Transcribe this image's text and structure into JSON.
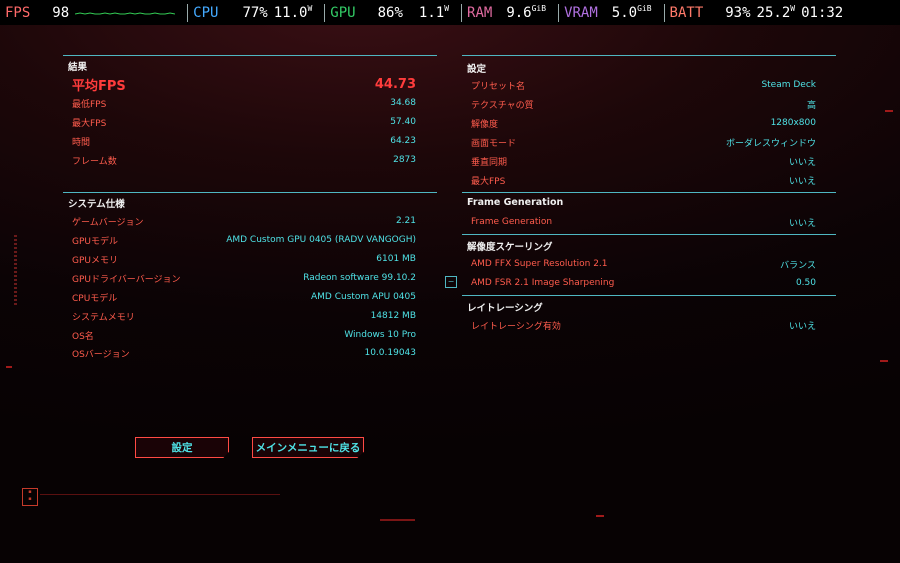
{
  "overlay": {
    "fps_label": "FPS",
    "fps_value": "98",
    "cpu_label": "CPU",
    "cpu_pct": "77%",
    "cpu_power": "11.0",
    "cpu_power_unit": "W",
    "gpu_label": "GPU",
    "gpu_pct": "86%",
    "gpu_power": "1.1",
    "gpu_power_unit": "W",
    "ram_label": "RAM",
    "ram_value": "9.6",
    "ram_unit": "GiB",
    "vram_label": "VRAM",
    "vram_value": "5.0",
    "vram_unit": "GiB",
    "batt_label": "BATT",
    "batt_pct": "93%",
    "batt_power": "25.2",
    "batt_power_unit": "W",
    "clock": "01:32",
    "colors": {
      "fps": "#ff6a6a",
      "cpu": "#44aaff",
      "gpu": "#33cc66",
      "ram": "#e06aa0",
      "vram": "#b070e0",
      "batt": "#ff7a6a"
    }
  },
  "results": {
    "title": "結果",
    "rows": [
      {
        "label": "平均FPS",
        "value": "44.73"
      },
      {
        "label": "最低FPS",
        "value": "34.68"
      },
      {
        "label": "最大FPS",
        "value": "57.40"
      },
      {
        "label": "時間",
        "value": "64.23"
      },
      {
        "label": "フレーム数",
        "value": "2873"
      }
    ]
  },
  "system": {
    "title": "システム仕様",
    "rows": [
      {
        "label": "ゲームバージョン",
        "value": "2.21"
      },
      {
        "label": "GPUモデル",
        "value": "AMD Custom GPU 0405 (RADV VANGOGH)"
      },
      {
        "label": "GPUメモリ",
        "value": "6101 MB"
      },
      {
        "label": "GPUドライバーバージョン",
        "value": "Radeon software 99.10.2"
      },
      {
        "label": "CPUモデル",
        "value": "AMD Custom APU 0405"
      },
      {
        "label": "システムメモリ",
        "value": "14812 MB"
      },
      {
        "label": "OS名",
        "value": "Windows 10 Pro"
      },
      {
        "label": "OSバージョン",
        "value": "10.0.19043"
      }
    ]
  },
  "settings": {
    "title": "設定",
    "rows": [
      {
        "label": "プリセット名",
        "value": "Steam Deck"
      },
      {
        "label": "テクスチャの質",
        "value": "高"
      },
      {
        "label": "解像度",
        "value": "1280x800"
      },
      {
        "label": "画面モード",
        "value": "ボーダレスウィンドウ"
      },
      {
        "label": "垂直同期",
        "value": "いいえ"
      },
      {
        "label": "最大FPS",
        "value": "いいえ"
      }
    ]
  },
  "framegen": {
    "title": "Frame Generation",
    "rows": [
      {
        "label": "Frame Generation",
        "value": "いいえ"
      }
    ]
  },
  "scaling": {
    "title": "解像度スケーリング",
    "rows": [
      {
        "label": "AMD FFX Super Resolution 2.1",
        "value": "バランス"
      },
      {
        "label": "AMD FSR 2.1 Image Sharpening",
        "value": "0.50"
      }
    ]
  },
  "raytracing": {
    "title": "レイトレーシング",
    "rows": [
      {
        "label": "レイトレーシング有効",
        "value": "いいえ"
      }
    ]
  },
  "buttons": {
    "settings": "設定",
    "main_menu": "メインメニューに戻る"
  },
  "toggle_glyph": "−"
}
